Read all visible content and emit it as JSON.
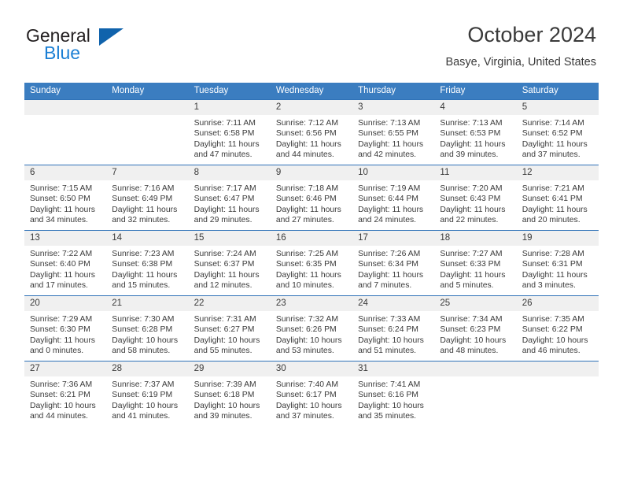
{
  "brand": {
    "name_top": "General",
    "name_bottom": "Blue",
    "accent_color": "#1063ac",
    "blue_text_color": "#1b7fd4"
  },
  "header": {
    "title": "October 2024",
    "location": "Basye, Virginia, United States"
  },
  "calendar": {
    "header_bg": "#3b7dc0",
    "daynum_bg": "#f0f0f0",
    "cell_border_color": "#2f72b8",
    "weekdays": [
      "Sunday",
      "Monday",
      "Tuesday",
      "Wednesday",
      "Thursday",
      "Friday",
      "Saturday"
    ],
    "weeks": [
      [
        {
          "day": "",
          "details": ""
        },
        {
          "day": "",
          "details": ""
        },
        {
          "day": "1",
          "details": "Sunrise: 7:11 AM\nSunset: 6:58 PM\nDaylight: 11 hours\nand 47 minutes."
        },
        {
          "day": "2",
          "details": "Sunrise: 7:12 AM\nSunset: 6:56 PM\nDaylight: 11 hours\nand 44 minutes."
        },
        {
          "day": "3",
          "details": "Sunrise: 7:13 AM\nSunset: 6:55 PM\nDaylight: 11 hours\nand 42 minutes."
        },
        {
          "day": "4",
          "details": "Sunrise: 7:13 AM\nSunset: 6:53 PM\nDaylight: 11 hours\nand 39 minutes."
        },
        {
          "day": "5",
          "details": "Sunrise: 7:14 AM\nSunset: 6:52 PM\nDaylight: 11 hours\nand 37 minutes."
        }
      ],
      [
        {
          "day": "6",
          "details": "Sunrise: 7:15 AM\nSunset: 6:50 PM\nDaylight: 11 hours\nand 34 minutes."
        },
        {
          "day": "7",
          "details": "Sunrise: 7:16 AM\nSunset: 6:49 PM\nDaylight: 11 hours\nand 32 minutes."
        },
        {
          "day": "8",
          "details": "Sunrise: 7:17 AM\nSunset: 6:47 PM\nDaylight: 11 hours\nand 29 minutes."
        },
        {
          "day": "9",
          "details": "Sunrise: 7:18 AM\nSunset: 6:46 PM\nDaylight: 11 hours\nand 27 minutes."
        },
        {
          "day": "10",
          "details": "Sunrise: 7:19 AM\nSunset: 6:44 PM\nDaylight: 11 hours\nand 24 minutes."
        },
        {
          "day": "11",
          "details": "Sunrise: 7:20 AM\nSunset: 6:43 PM\nDaylight: 11 hours\nand 22 minutes."
        },
        {
          "day": "12",
          "details": "Sunrise: 7:21 AM\nSunset: 6:41 PM\nDaylight: 11 hours\nand 20 minutes."
        }
      ],
      [
        {
          "day": "13",
          "details": "Sunrise: 7:22 AM\nSunset: 6:40 PM\nDaylight: 11 hours\nand 17 minutes."
        },
        {
          "day": "14",
          "details": "Sunrise: 7:23 AM\nSunset: 6:38 PM\nDaylight: 11 hours\nand 15 minutes."
        },
        {
          "day": "15",
          "details": "Sunrise: 7:24 AM\nSunset: 6:37 PM\nDaylight: 11 hours\nand 12 minutes."
        },
        {
          "day": "16",
          "details": "Sunrise: 7:25 AM\nSunset: 6:35 PM\nDaylight: 11 hours\nand 10 minutes."
        },
        {
          "day": "17",
          "details": "Sunrise: 7:26 AM\nSunset: 6:34 PM\nDaylight: 11 hours\nand 7 minutes."
        },
        {
          "day": "18",
          "details": "Sunrise: 7:27 AM\nSunset: 6:33 PM\nDaylight: 11 hours\nand 5 minutes."
        },
        {
          "day": "19",
          "details": "Sunrise: 7:28 AM\nSunset: 6:31 PM\nDaylight: 11 hours\nand 3 minutes."
        }
      ],
      [
        {
          "day": "20",
          "details": "Sunrise: 7:29 AM\nSunset: 6:30 PM\nDaylight: 11 hours\nand 0 minutes."
        },
        {
          "day": "21",
          "details": "Sunrise: 7:30 AM\nSunset: 6:28 PM\nDaylight: 10 hours\nand 58 minutes."
        },
        {
          "day": "22",
          "details": "Sunrise: 7:31 AM\nSunset: 6:27 PM\nDaylight: 10 hours\nand 55 minutes."
        },
        {
          "day": "23",
          "details": "Sunrise: 7:32 AM\nSunset: 6:26 PM\nDaylight: 10 hours\nand 53 minutes."
        },
        {
          "day": "24",
          "details": "Sunrise: 7:33 AM\nSunset: 6:24 PM\nDaylight: 10 hours\nand 51 minutes."
        },
        {
          "day": "25",
          "details": "Sunrise: 7:34 AM\nSunset: 6:23 PM\nDaylight: 10 hours\nand 48 minutes."
        },
        {
          "day": "26",
          "details": "Sunrise: 7:35 AM\nSunset: 6:22 PM\nDaylight: 10 hours\nand 46 minutes."
        }
      ],
      [
        {
          "day": "27",
          "details": "Sunrise: 7:36 AM\nSunset: 6:21 PM\nDaylight: 10 hours\nand 44 minutes."
        },
        {
          "day": "28",
          "details": "Sunrise: 7:37 AM\nSunset: 6:19 PM\nDaylight: 10 hours\nand 41 minutes."
        },
        {
          "day": "29",
          "details": "Sunrise: 7:39 AM\nSunset: 6:18 PM\nDaylight: 10 hours\nand 39 minutes."
        },
        {
          "day": "30",
          "details": "Sunrise: 7:40 AM\nSunset: 6:17 PM\nDaylight: 10 hours\nand 37 minutes."
        },
        {
          "day": "31",
          "details": "Sunrise: 7:41 AM\nSunset: 6:16 PM\nDaylight: 10 hours\nand 35 minutes."
        },
        {
          "day": "",
          "details": ""
        },
        {
          "day": "",
          "details": ""
        }
      ]
    ]
  }
}
